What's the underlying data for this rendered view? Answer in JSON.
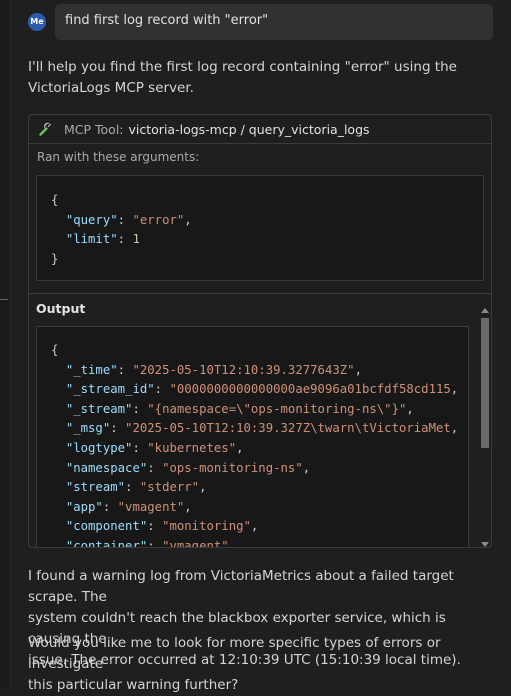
{
  "user": {
    "avatar_initials": "Me",
    "message": "find first log record with \"error\""
  },
  "assistant": {
    "intro_line1": "I'll help you find the first log record containing \"error\" using the",
    "intro_line2": "VictoriaLogs MCP server.",
    "result_line1": "I found a warning log from VictoriaMetrics about a failed target scrape. The",
    "result_line2": "system couldn't reach the blackbox exporter service, which is causing the",
    "result_line3": "issue. The error occurred at 12:10:39 UTC (15:10:39 local time).",
    "followup_line1": "Would you like me to look for more specific types of errors or investigate",
    "followup_line2": "this particular warning further?"
  },
  "tool": {
    "prefix": "MCP Tool:",
    "name": "victoria-logs-mcp / query_victoria_logs",
    "args_label": "Ran with these arguments:",
    "args": [
      {
        "key": "query",
        "value": "\"error\"",
        "type": "string"
      },
      {
        "key": "limit",
        "value": "1",
        "type": "number"
      }
    ],
    "output_label": "Output",
    "output": [
      {
        "key": "_time",
        "value": "\"2025-05-10T12:10:39.3277643Z\""
      },
      {
        "key": "_stream_id",
        "value": "\"0000000000000000ae9096a01bcfdf58cd115"
      },
      {
        "key": "_stream",
        "value": "\"{namespace=\\\"ops-monitoring-ns\\\"}\""
      },
      {
        "key": "_msg",
        "value": "\"2025-05-10T12:10:39.327Z\\twarn\\tVictoriaMet"
      },
      {
        "key": "logtype",
        "value": "\"kubernetes\""
      },
      {
        "key": "namespace",
        "value": "\"ops-monitoring-ns\""
      },
      {
        "key": "stream",
        "value": "\"stderr\""
      },
      {
        "key": "app",
        "value": "\"vmagent\""
      },
      {
        "key": "component",
        "value": "\"monitoring\""
      },
      {
        "key": "container",
        "value": "\"vmagent\""
      }
    ]
  },
  "icons": {
    "tool": "wrench-icon"
  }
}
